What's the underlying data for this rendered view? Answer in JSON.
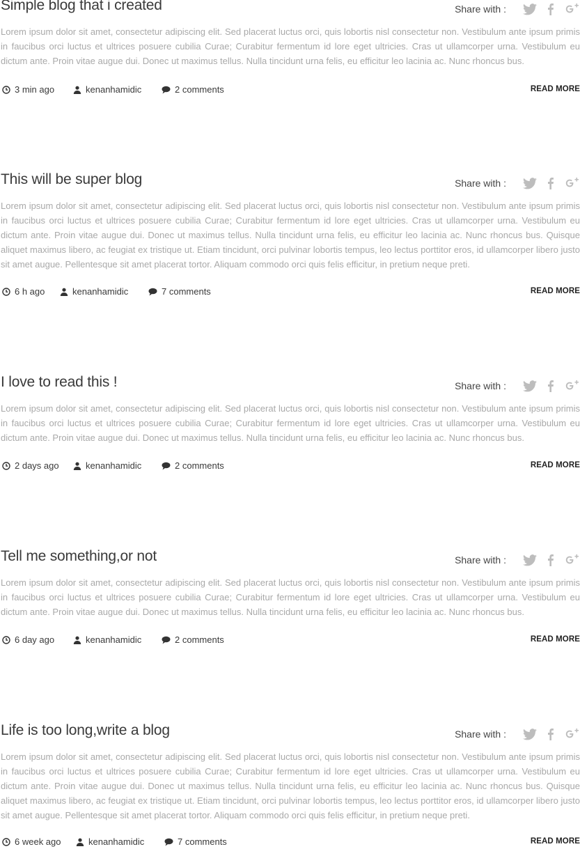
{
  "share_label": "Share with :",
  "read_more_label": "READ MORE",
  "icons": {
    "twitter": "twitter-icon",
    "facebook": "facebook-icon",
    "googleplus": "googleplus-icon",
    "clock": "clock-icon",
    "user": "user-icon",
    "comment": "comment-icon"
  },
  "colors": {
    "title": "#3a3a3a",
    "excerpt": "#a9a9a9",
    "icon": "#bdbdbd"
  },
  "posts": [
    {
      "title": "Simple blog that i created",
      "excerpt": "Lorem ipsum dolor sit amet, consectetur adipiscing elit. Sed placerat luctus orci, quis lobortis nisl consectetur non. Vestibulum ante ipsum primis in faucibus orci luctus et ultrices posuere cubilia Curae; Curabitur fermentum id lore eget ultricies. Cras ut ullamcorper urna. Vestibulum eu dictum ante. Proin vitae augue dui. Donec ut maximus tellus. Nulla tincidunt urna felis, eu efficitur leo lacinia ac. Nunc rhoncus bus.",
      "time": "3 min ago",
      "author": "kenanhamidic",
      "comments": "2 comments"
    },
    {
      "title": "This will be super blog",
      "excerpt": "Lorem ipsum dolor sit amet, consectetur adipiscing elit. Sed placerat luctus orci, quis lobortis nisl consectetur non. Vestibulum ante ipsum primis in faucibus orci luctus et ultrices posuere cubilia Curae; Curabitur fermentum id lore eget ultricies. Cras ut ullamcorper urna. Vestibulum eu dictum ante. Proin vitae augue dui. Donec ut maximus tellus. Nulla tincidunt urna felis, eu efficitur leo lacinia ac. Nunc rhoncus bus. Quisque aliquet maximus libero, ac feugiat ex tristique ut. Etiam tincidunt, orci pulvinar lobortis tempus, leo lectus porttitor eros, id ullamcorper libero justo sit amet augue. Pellentesque sit amet placerat tortor. Aliquam commodo orci quis felis efficitur, in pretium neque preti.",
      "time": "6 h ago",
      "author": "kenanhamidic",
      "comments": "7 comments"
    },
    {
      "title": "I love to read this !",
      "excerpt": "Lorem ipsum dolor sit amet, consectetur adipiscing elit. Sed placerat luctus orci, quis lobortis nisl consectetur non. Vestibulum ante ipsum primis in faucibus orci luctus et ultrices posuere cubilia Curae; Curabitur fermentum id lore eget ultricies. Cras ut ullamcorper urna. Vestibulum eu dictum ante. Proin vitae augue dui. Donec ut maximus tellus. Nulla tincidunt urna felis, eu efficitur leo lacinia ac. Nunc rhoncus bus.",
      "time": "2 days ago",
      "author": "kenanhamidic",
      "comments": "2 comments"
    },
    {
      "title": "Tell me something,or not",
      "excerpt": "Lorem ipsum dolor sit amet, consectetur adipiscing elit. Sed placerat luctus orci, quis lobortis nisl consectetur non. Vestibulum ante ipsum primis in faucibus orci luctus et ultrices posuere cubilia Curae; Curabitur fermentum id lore eget ultricies. Cras ut ullamcorper urna. Vestibulum eu dictum ante. Proin vitae augue dui. Donec ut maximus tellus. Nulla tincidunt urna felis, eu efficitur leo lacinia ac. Nunc rhoncus bus.",
      "time": "6 day ago",
      "author": "kenanhamidic",
      "comments": "2 comments"
    },
    {
      "title": "Life is too long,write a blog",
      "excerpt": "Lorem ipsum dolor sit amet, consectetur adipiscing elit. Sed placerat luctus orci, quis lobortis nisl consectetur non. Vestibulum ante ipsum primis in faucibus orci luctus et ultrices posuere cubilia Curae; Curabitur fermentum id lore eget ultricies. Cras ut ullamcorper urna. Vestibulum eu dictum ante. Proin vitae augue dui. Donec ut maximus tellus. Nulla tincidunt urna felis, eu efficitur leo lacinia ac. Nunc rhoncus bus. Quisque aliquet maximus libero, ac feugiat ex tristique ut. Etiam tincidunt, orci pulvinar lobortis tempus, leo lectus porttitor eros, id ullamcorper libero justo sit amet augue. Pellentesque sit amet placerat tortor. Aliquam commodo orci quis felis efficitur, in pretium neque preti.",
      "time": "6 week ago",
      "author": "kenanhamidic",
      "comments": "7 comments"
    }
  ]
}
